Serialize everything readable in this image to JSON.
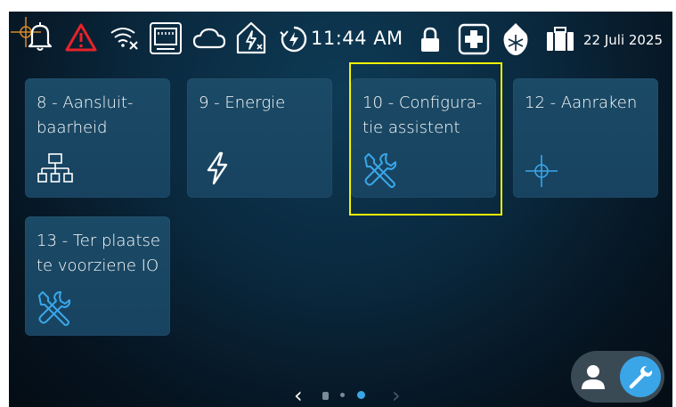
{
  "status_bar": {
    "icons": [
      "crosshair-icon",
      "bell-icon",
      "warning-icon",
      "wifi-off-icon",
      "network-port-icon",
      "cloud-icon",
      "home-energy-icon",
      "power-timer-icon",
      "lock-icon",
      "medical-cross-icon",
      "snow-icon",
      "luggage-icon"
    ],
    "time": "11:44 AM",
    "date": "22 Juli 2025",
    "warning_color": "#e8222a",
    "accent_color": "#3aa6e8"
  },
  "tiles": [
    {
      "label": "8 - Aansluit-baarheid",
      "label_lines": [
        "8 - Aansluit-",
        "baarheid"
      ],
      "icon": "network-icon"
    },
    {
      "label": "9 - Energie",
      "label_lines": [
        "9 - Energie"
      ],
      "icon": "lightning-icon"
    },
    {
      "label": "10 - Configuratie assistent",
      "label_lines": [
        "10 - Configura-",
        "tie assistent"
      ],
      "icon": "tools-icon"
    },
    {
      "label": "12 - Aanraken",
      "label_lines": [
        "12 - Aanraken"
      ],
      "icon": "crosshair-target-icon"
    },
    {
      "label": "13 - Ter plaatse te voorziene IO",
      "label_lines": [
        "13 - Ter plaatse",
        "te voorziene IO"
      ],
      "icon": "tools-icon"
    }
  ],
  "pager": {
    "prev_glyph": "‹",
    "next_glyph": "›",
    "page_count": 3,
    "active_page": 3
  },
  "bottom_right": {
    "user_icon": "user-icon",
    "service_icon": "wrench-icon"
  }
}
